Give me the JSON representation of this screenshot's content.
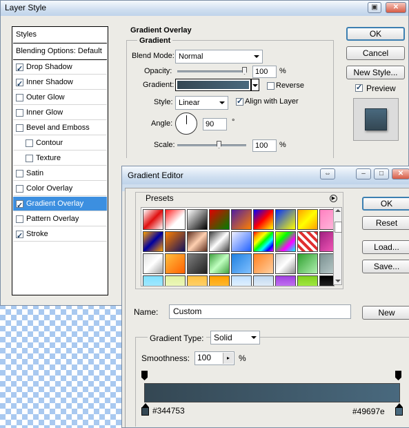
{
  "layer_style": {
    "title": "Layer Style",
    "styles_header": "Styles",
    "blending_options": "Blending Options: Default",
    "styles": [
      {
        "label": "Drop Shadow",
        "checked": true,
        "selected": false,
        "indent": false
      },
      {
        "label": "Inner Shadow",
        "checked": true,
        "selected": false,
        "indent": false
      },
      {
        "label": "Outer Glow",
        "checked": false,
        "selected": false,
        "indent": false
      },
      {
        "label": "Inner Glow",
        "checked": false,
        "selected": false,
        "indent": false
      },
      {
        "label": "Bevel and Emboss",
        "checked": false,
        "selected": false,
        "indent": false
      },
      {
        "label": "Contour",
        "checked": false,
        "selected": false,
        "indent": true
      },
      {
        "label": "Texture",
        "checked": false,
        "selected": false,
        "indent": true
      },
      {
        "label": "Satin",
        "checked": false,
        "selected": false,
        "indent": false
      },
      {
        "label": "Color Overlay",
        "checked": false,
        "selected": false,
        "indent": false
      },
      {
        "label": "Gradient Overlay",
        "checked": true,
        "selected": true,
        "indent": false
      },
      {
        "label": "Pattern Overlay",
        "checked": false,
        "selected": false,
        "indent": false
      },
      {
        "label": "Stroke",
        "checked": true,
        "selected": false,
        "indent": false
      }
    ],
    "section_title": "Gradient Overlay",
    "group_title": "Gradient",
    "blend_mode_label": "Blend Mode:",
    "blend_mode_value": "Normal",
    "opacity_label": "Opacity:",
    "opacity_value": "100",
    "opacity_unit": "%",
    "gradient_label": "Gradient:",
    "reverse_label": "Reverse",
    "reverse_checked": false,
    "style_label": "Style:",
    "style_value": "Linear",
    "align_label": "Align with Layer",
    "align_checked": true,
    "angle_label": "Angle:",
    "angle_value": "90",
    "angle_unit": "°",
    "scale_label": "Scale:",
    "scale_value": "100",
    "scale_unit": "%",
    "ok_label": "OK",
    "cancel_label": "Cancel",
    "new_style_label": "New Style...",
    "preview_label": "Preview",
    "preview_checked": true
  },
  "gradient_editor": {
    "title": "Gradient Editor",
    "presets_label": "Presets",
    "ok_label": "OK",
    "reset_label": "Reset",
    "load_label": "Load...",
    "save_label": "Save...",
    "name_label": "Name:",
    "name_value": "Custom",
    "new_label": "New",
    "gradient_type_label": "Gradient Type:",
    "gradient_type_value": "Solid",
    "smoothness_label": "Smoothness:",
    "smoothness_value": "100",
    "smoothness_unit": "%",
    "stop_left_color": "#344753",
    "stop_right_color": "#49697e",
    "stop_left_label": "#344753",
    "stop_right_label": "#49697e"
  },
  "colors": {
    "gradient_start": "#344753",
    "gradient_end": "#49697e",
    "selection": "#3c8fe0",
    "dialog_bg": "#ecebe6"
  }
}
